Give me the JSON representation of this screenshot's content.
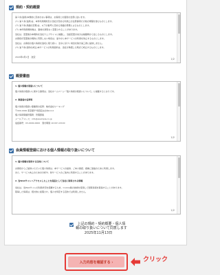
{
  "section1": {
    "title": "規約・契約概要",
    "lines": [
      "第１条(適用)本規約に定めのない事項は、お客様との個別の合意に従います。",
      "(１) 第１条(適用)は、本件利用規約及び当社が定める利用上の注意事項その他の規程を含むものとします。",
      "(２) 第２条(用語の定義)は、以下の各号に定める用語の意義によるものとします。",
      "(３) 本件利用規約等は、事前の通知なく変更されることがあります。",
      "当社は、変更後の本規約を当社ウェブサイトに掲載し、当該変更の効力は掲載時から生じるものとします。",
      "お客様が変更後の規約に同意しない場合は、速やかに本サービスの利用を停止するものとします。",
      "当社は、お客様の個人情報を適切に取り扱い、法令に基づく場合を除き第三者に提供しません。",
      "(４) 第３条(契約の成立)本サービスの利用契約は、当社が承諾した時点で成立するものとします。",
      "2024年2月1日　改定"
    ],
    "page": "1/2"
  },
  "section2": {
    "title": "概要書面",
    "heading1": "1. 個人情報の取扱いについて",
    "body1": "個人情報の取扱いに関する事項は、当社ホームページ「個人情報の取扱いについて」に掲載するとおりです。",
    "heading2": "2. 事業者の名称等",
    "lines2": [
      "個人情報の取扱い事業者の名称：株式会社ワーキング",
      "〒000-0000 東京都千代田区丸の内0-0-0",
      "個人情報保護管理者：管理部長",
      "メールアドレス：info@example.co.jp",
      "電話番号：03-0000-0000　受付時間 10:00〜18:00"
    ],
    "page": "1/2"
  },
  "section3": {
    "title": "会員情報登録における個人情報の取り扱いについて",
    "heading1": "1. 個人情報を取得する目的について",
    "lines1": [
      "お客様からご提供いただいた個人情報は、本サービスの提供、ご本人確認、各種ご連絡のために利用します。",
      "また、サービス向上のための分析や、新サービスのご案内に利用することがあります。"
    ],
    "heading2": "2. 当Webサイトへアクセスしたことを起因として当社に取得される情報",
    "lines2": [
      "当社は、当Webサイトの利用状況を把握するため、Cookie等の技術を使用して閲覧情報を取得することがあります。",
      "取得した情報は、統計的に処理され、個人を特定する目的では利用しません。"
    ],
    "page": "1/2"
  },
  "agree": {
    "line1": "上記の規約・契約概要・個人情",
    "line2": "報の取り扱いについて同意します",
    "date": "2025年11月13日"
  },
  "button": {
    "label": "入力内容を確認する ›"
  },
  "annotation": {
    "label": "クリック"
  },
  "colors": {
    "accent": "#3a6ea5",
    "highlight": "#e53935",
    "button_bg": "#f5b3b3"
  }
}
